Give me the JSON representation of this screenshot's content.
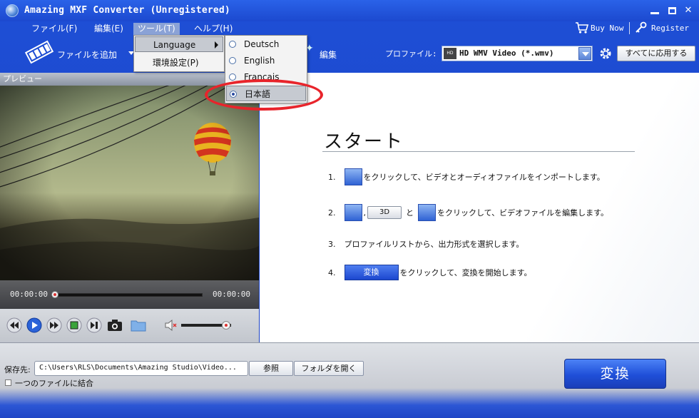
{
  "window": {
    "title": "Amazing MXF Converter (Unregistered)"
  },
  "menubar": {
    "items": [
      {
        "label": "ファイル(F)"
      },
      {
        "label": "編集(E)"
      },
      {
        "label": "ツール(T)"
      },
      {
        "label": "ヘルプ(H)"
      }
    ],
    "buy_now": "Buy Now",
    "register": "Register"
  },
  "tools_menu": {
    "items": [
      {
        "label": "Language"
      },
      {
        "label": "環境設定(P)"
      }
    ]
  },
  "language_menu": {
    "items": [
      {
        "label": "Deutsch",
        "selected": false
      },
      {
        "label": "English",
        "selected": false
      },
      {
        "label": "Français",
        "selected": false
      },
      {
        "label": "日本語",
        "selected": true
      }
    ]
  },
  "toolbar": {
    "add_file": "ファイルを追加",
    "edit": "編集",
    "profile_label": "プロファイル:",
    "profile_value": "HD WMV Video (*.wmv)",
    "profile_icon_text": "HD",
    "apply_all": "すべてに応用する"
  },
  "preview": {
    "header": "プレビュー",
    "time_current": "00:00:00",
    "time_total": "00:00:00",
    "volume_level": 0.9
  },
  "start": {
    "title": "スタート",
    "steps": [
      {
        "num": "1.",
        "text": "をクリックして、ビデオとオーディオファイルをインポートします。"
      },
      {
        "num": "2.",
        "sep1": ",",
        "btn3d": "3D",
        "and": "と",
        "text": "をクリックして、ビデオファイルを編集します。"
      },
      {
        "num": "3.",
        "text": "プロファイルリストから、出力形式を選択します。"
      },
      {
        "num": "4.",
        "button": "変換",
        "text": "をクリックして、変換を開始します。"
      }
    ]
  },
  "bottom": {
    "save_label": "保存先:",
    "save_path": "C:\\Users\\RLS\\Documents\\Amazing Studio\\Video...",
    "browse": "参照",
    "open_folder": "フォルダを開く",
    "merge_label": "一つのファイルに結合",
    "merge_checked": false,
    "convert": "変換"
  },
  "colors": {
    "accent": "#1f47c8",
    "highlight": "#e8242b"
  }
}
